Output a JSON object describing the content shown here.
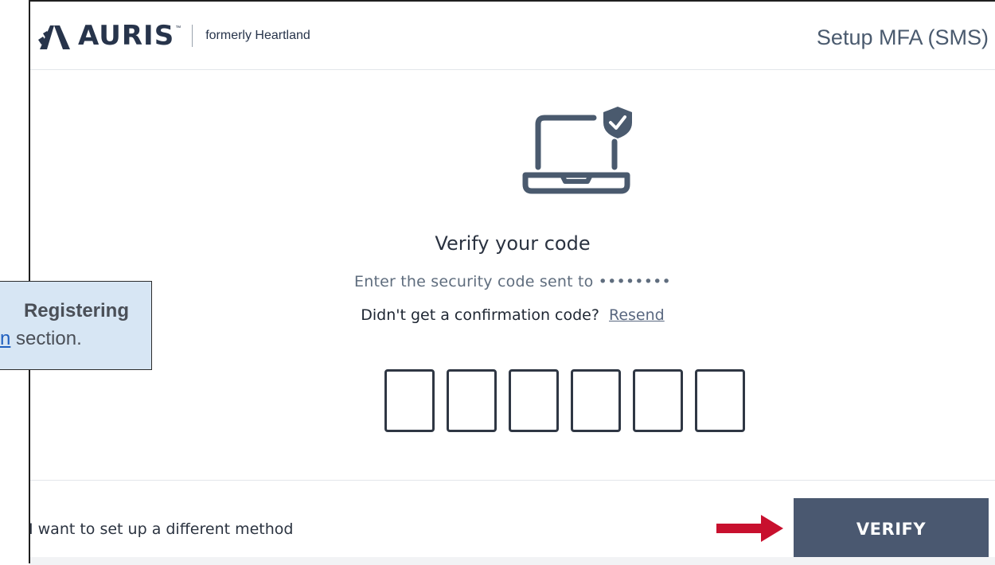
{
  "header": {
    "brand": "AURIS",
    "trademark": "™",
    "formerly": "formerly Heartland",
    "title": "Setup MFA (SMS)"
  },
  "main": {
    "heading": "Verify your code",
    "instruction": "Enter the security code sent to ••••••••",
    "resend_prompt": "Didn't get a confirmation code?",
    "resend_link": "Resend",
    "code_digits": [
      "",
      "",
      "",
      "",
      "",
      ""
    ]
  },
  "footer": {
    "alt_method": "I want to set up a different method",
    "verify_label": "VERIFY"
  },
  "callout": {
    "line1": "Registering",
    "link_text": "n",
    "line2_rest": " section."
  },
  "colors": {
    "brand": "#27344b",
    "button": "#4a5870",
    "arrow": "#c8102e",
    "callout_bg": "#d7e6f4",
    "link": "#1f5fbf"
  }
}
